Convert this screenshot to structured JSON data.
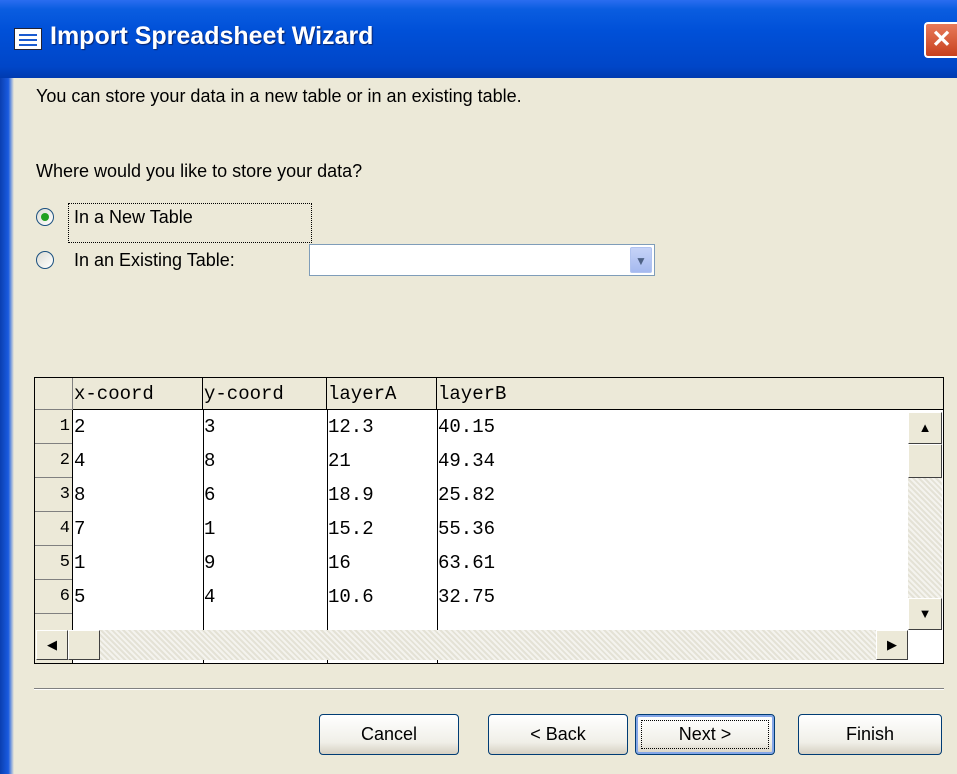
{
  "window": {
    "title": "Import Spreadsheet Wizard",
    "close_glyph": "✕"
  },
  "intro_text": "You can store your data in a new table or in an existing table.",
  "question_text": "Where would you like to store your data?",
  "options": [
    {
      "label": "In a New Table",
      "selected": true
    },
    {
      "label": "In an Existing Table:",
      "selected": false
    }
  ],
  "existing_table_select": {
    "value": "",
    "arrow_icon": "chevron-down-icon"
  },
  "grid": {
    "columns": [
      "x-coord",
      "y-coord",
      "layerA",
      "layerB"
    ],
    "rows": [
      {
        "num": "1",
        "cells": [
          "2",
          "3",
          "12.3",
          "40.15"
        ]
      },
      {
        "num": "2",
        "cells": [
          "4",
          "8",
          "21",
          "49.34"
        ]
      },
      {
        "num": "3",
        "cells": [
          "8",
          "6",
          "18.9",
          "25.82"
        ]
      },
      {
        "num": "4",
        "cells": [
          "7",
          "1",
          "15.2",
          "55.36"
        ]
      },
      {
        "num": "5",
        "cells": [
          "1",
          "9",
          "16",
          "63.61"
        ]
      },
      {
        "num": "6",
        "cells": [
          "5",
          "4",
          "10.6",
          "32.75"
        ]
      }
    ]
  },
  "scroll_glyphs": {
    "up": "▲",
    "down": "▼",
    "left": "◀",
    "right": "▶"
  },
  "buttons": {
    "cancel": "Cancel",
    "back": "< Back",
    "next": "Next >",
    "finish": "Finish"
  },
  "colors": {
    "titlebar": "#0050d8",
    "window_bg": "#ece9d8",
    "radio_dot": "#21a121",
    "close": "#c8411e"
  }
}
